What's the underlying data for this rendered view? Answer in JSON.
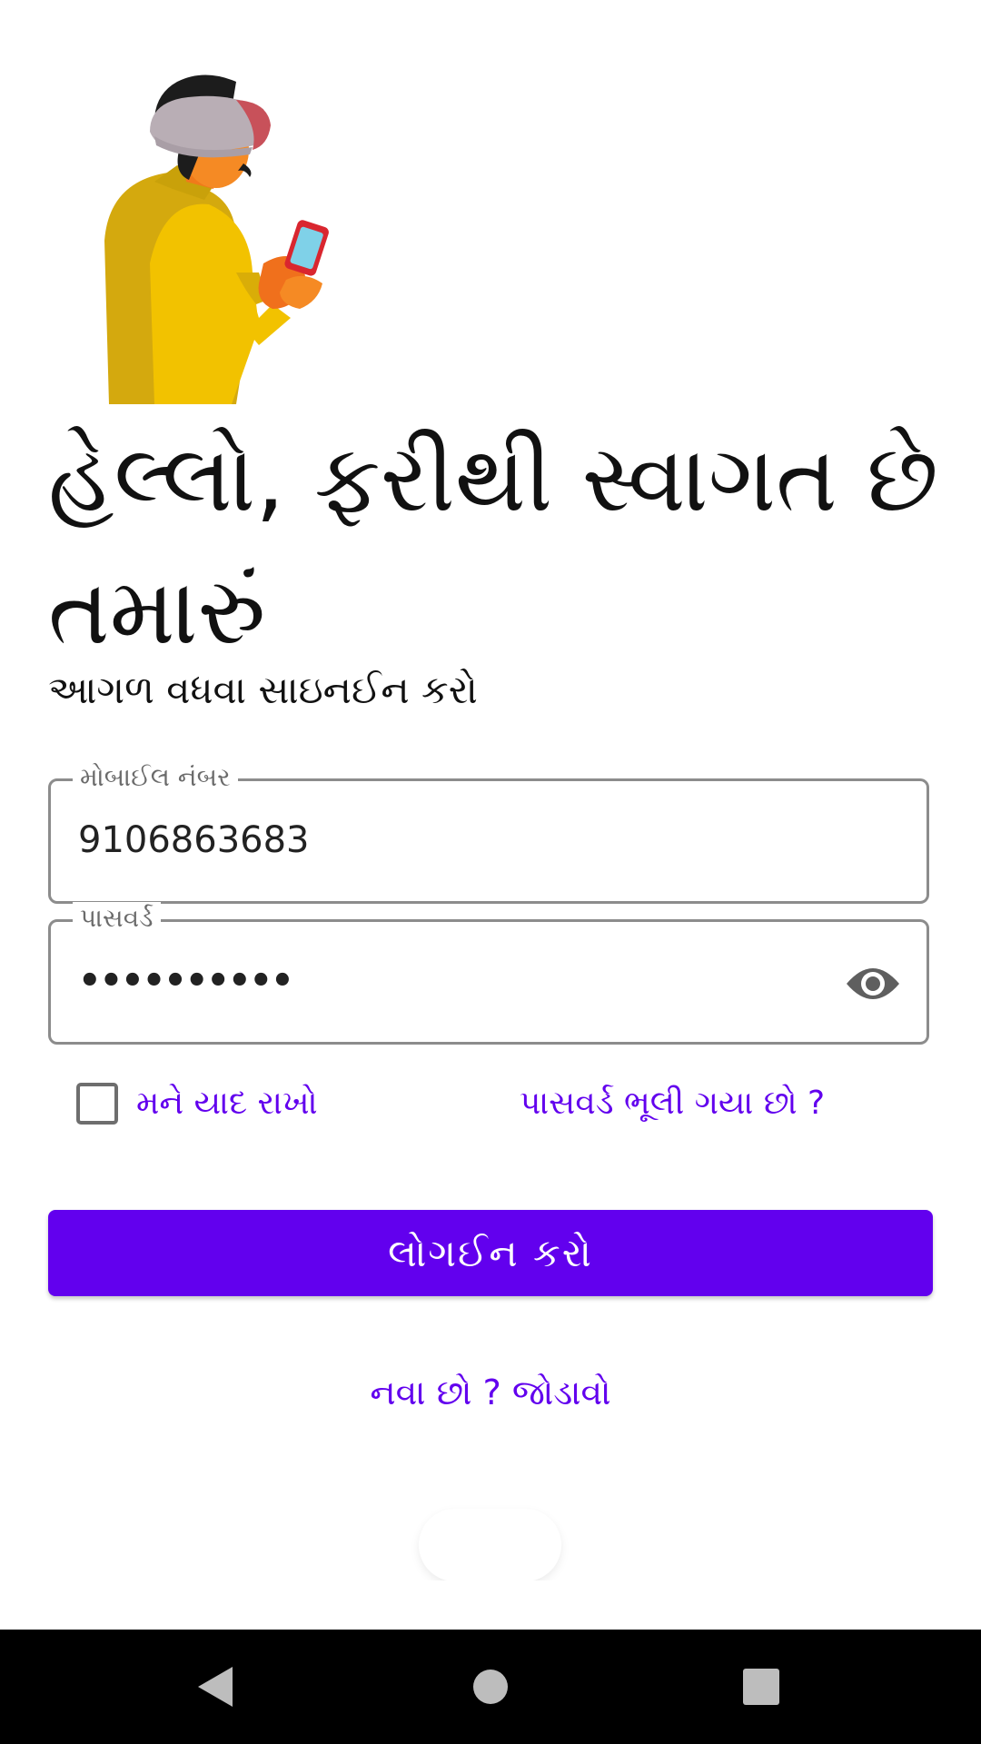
{
  "greeting": "હેલ્લો, ફરીથી સ્વાગત છે તમારું",
  "subtitle": "આગળ વધવા સાઇનઈન કરો",
  "mobile_field": {
    "label": "મોબાઈલ નંબર",
    "value": "9106863683"
  },
  "password_field": {
    "label": "પાસવર્ડ",
    "value": "••••••••••",
    "toggle_icon": "eye-icon"
  },
  "remember_me": {
    "label": "મને યાદ રાખો",
    "checked": false
  },
  "forgot_password": "પાસવર્ડ ભૂલી ગયા છો ?",
  "login_button": "લોગઈન કરો",
  "signup_link": "નવા છો ? જોડાવો",
  "colors": {
    "accent": "#6200ee",
    "field_border": "#8c8c8c",
    "navbar": "#000000"
  },
  "navbar": {
    "back": "back-triangle-icon",
    "home": "home-circle-icon",
    "recent": "recents-square-icon"
  }
}
